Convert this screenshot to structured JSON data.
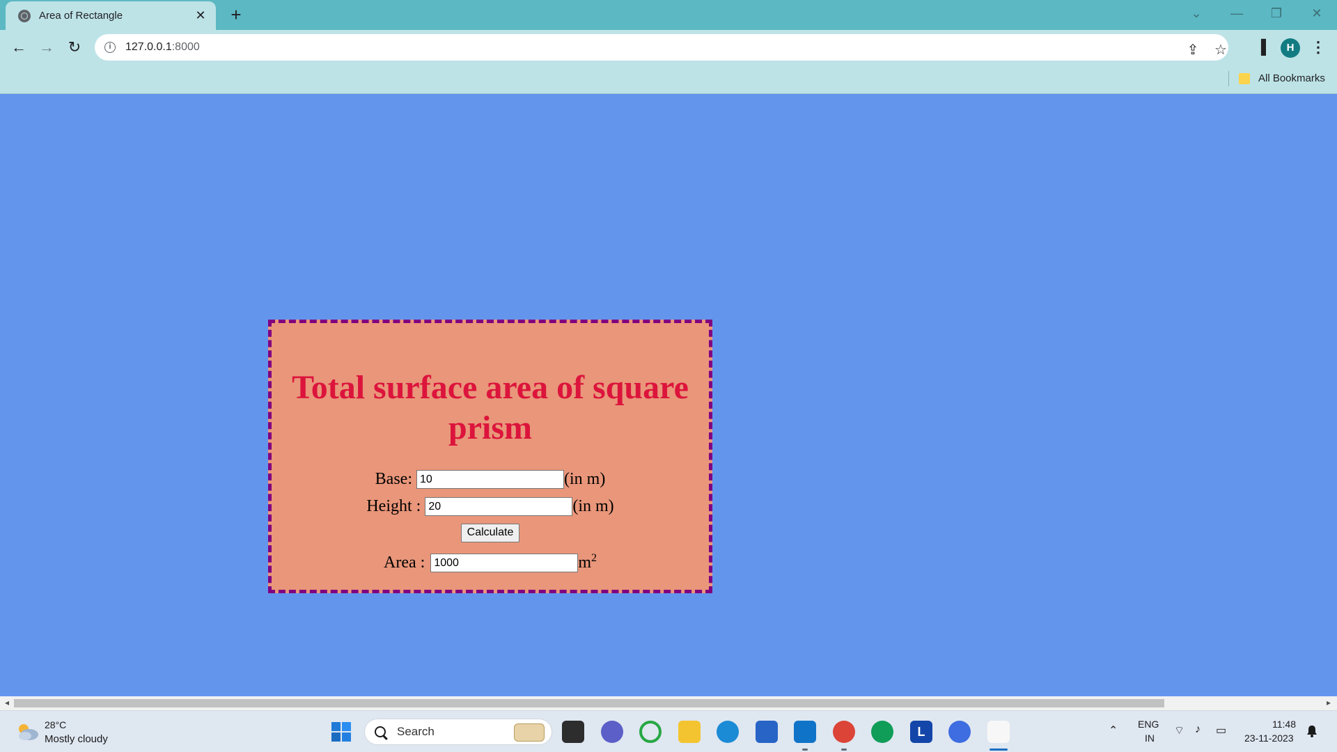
{
  "browser": {
    "tab_title": "Area of Rectangle",
    "tab_close": "✕",
    "new_tab": "+",
    "url_host": "127.0.0.1",
    "url_port": ":8000",
    "avatar_letter": "H",
    "bookmarks_label": "All Bookmarks"
  },
  "page": {
    "heading": "Total surface area of square prism",
    "base_label": "Base:",
    "base_value": "10",
    "base_unit": "(in m)",
    "height_label": "Height :",
    "height_value": "20",
    "height_unit": "(in m)",
    "calc_button": "Calculate",
    "area_label": "Area :",
    "area_value": "1000",
    "area_unit": "m",
    "area_unit_sup": "2"
  },
  "taskbar": {
    "weather_temp": "28°C",
    "weather_desc": "Mostly cloudy",
    "search_placeholder": "Search",
    "lang_top": "ENG",
    "lang_bottom": "IN",
    "time": "11:48",
    "date": "23-11-2023"
  },
  "colors": {
    "page_bg": "#6495ED",
    "card_bg": "#E9967A",
    "card_border": "#800080",
    "heading": "#DC143C"
  }
}
